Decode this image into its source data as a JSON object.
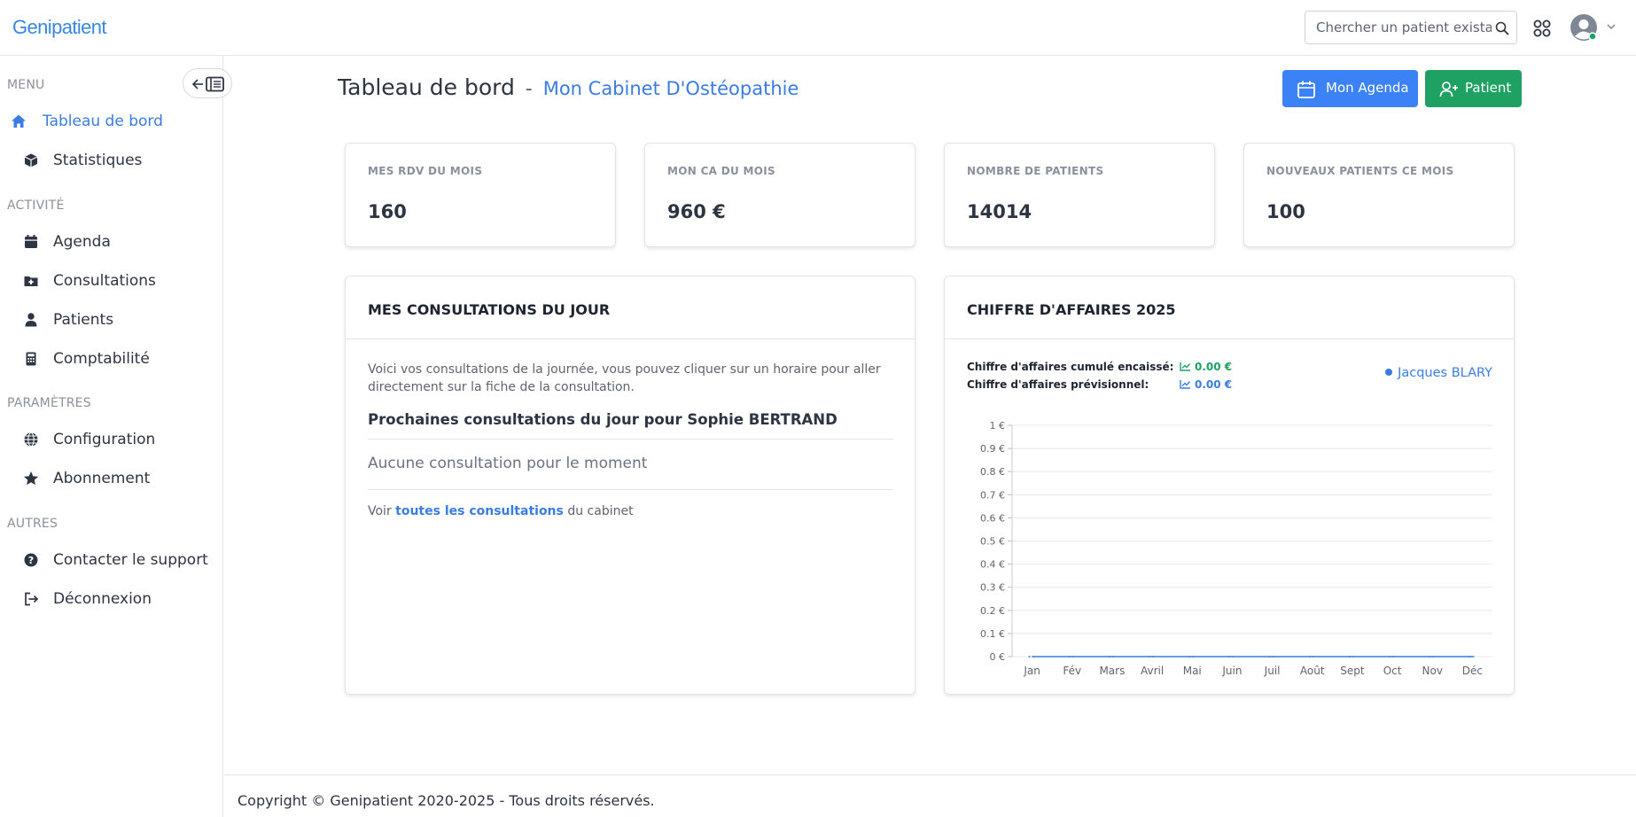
{
  "app": {
    "logo": "Genipatient"
  },
  "header": {
    "search_placeholder": "Chercher un patient exista...",
    "icons": [
      "search-icon",
      "apps-grid-icon",
      "user-avatar-icon",
      "chevron-down-icon"
    ]
  },
  "sidebar": {
    "sections": [
      {
        "title": "MENU",
        "items": [
          {
            "label": "Tableau de bord",
            "icon": "home-icon",
            "active": true
          },
          {
            "label": "Statistiques",
            "icon": "cube-icon"
          }
        ]
      },
      {
        "title": "ACTIVITÉ",
        "items": [
          {
            "label": "Agenda",
            "icon": "calendar-icon"
          },
          {
            "label": "Consultations",
            "icon": "folder-plus-icon"
          },
          {
            "label": "Patients",
            "icon": "user-icon"
          },
          {
            "label": "Comptabilité",
            "icon": "calculator-icon"
          }
        ]
      },
      {
        "title": "PARAMÈTRES",
        "items": [
          {
            "label": "Configuration",
            "icon": "globe-icon"
          },
          {
            "label": "Abonnement",
            "icon": "star-icon"
          }
        ]
      },
      {
        "title": "AUTRES",
        "items": [
          {
            "label": "Contacter le support",
            "icon": "question-circle-icon"
          },
          {
            "label": "Déconnexion",
            "icon": "logout-icon"
          }
        ]
      }
    ]
  },
  "page": {
    "title": "Tableau de bord",
    "separator": "-",
    "subtitle": "Mon Cabinet D'Ostéopathie",
    "agenda_button": "Mon Agenda",
    "patient_button": "Patient"
  },
  "stats": [
    {
      "label": "MES RDV DU MOIS",
      "value": "160"
    },
    {
      "label": "MON CA DU MOIS",
      "value": "960 €"
    },
    {
      "label": "NOMBRE DE PATIENTS",
      "value": "14014"
    },
    {
      "label": "NOUVEAUX PATIENTS CE MOIS",
      "value": "100"
    }
  ],
  "consultations": {
    "title": "MES CONSULTATIONS DU JOUR",
    "intro": "Voici vos consultations de la journée, vous pouvez cliquer sur un horaire pour aller directement sur la fiche de la consultation.",
    "next_title": "Prochaines consultations du jour pour Sophie BERTRAND",
    "empty": "Aucune consultation pour le moment",
    "voir_prefix": "Voir",
    "voir_link": "toutes les consultations",
    "voir_suffix": "du cabinet"
  },
  "revenue": {
    "title": "CHIFFRE D'AFFAIRES 2025",
    "cumul_label": "Chiffre d'affaires cumulé encaissé:",
    "cumul_value": "0.00 €",
    "previsionnel_label": "Chiffre d'affaires prévisionnel:",
    "previsionnel_value": "0.00 €",
    "legend": "Jacques BLARY",
    "colors": {
      "series": "#3a7ce2",
      "cumul": "#1fa163"
    }
  },
  "chart_data": {
    "type": "line",
    "categories": [
      "Jan",
      "Fév",
      "Mars",
      "Avril",
      "Mai",
      "Juin",
      "Juil",
      "Août",
      "Sept",
      "Oct",
      "Nov",
      "Déc"
    ],
    "series": [
      {
        "name": "Jacques BLARY",
        "values": [
          0,
          0,
          0,
          0,
          0,
          0,
          0,
          0,
          0,
          0,
          0,
          0
        ]
      }
    ],
    "y_ticks": [
      "0 €",
      "0.1 €",
      "0.2 €",
      "0.3 €",
      "0.4 €",
      "0.5 €",
      "0.6 €",
      "0.7 €",
      "0.8 €",
      "0.9 €",
      "1 €"
    ],
    "ylim": [
      0,
      1
    ],
    "grid": true,
    "legend_position": "top-right"
  },
  "footer": {
    "text": "Copyright © Genipatient 2020-2025 - Tous droits réservés."
  }
}
